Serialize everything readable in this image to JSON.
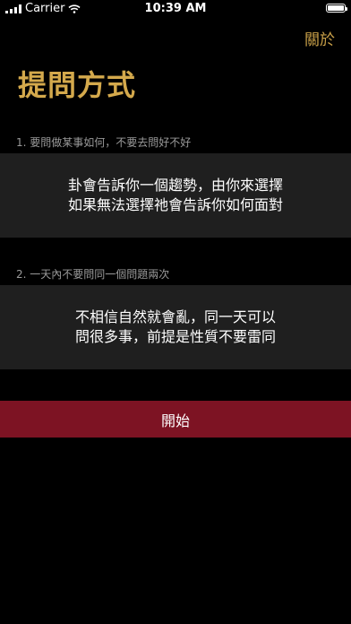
{
  "status_bar": {
    "carrier": "Carrier",
    "time": "10:39 AM",
    "wifi_icon": "wifi-icon",
    "battery_icon": "battery-icon",
    "battery_level": 1.0
  },
  "header": {
    "about_label": "關於",
    "title": "提問方式"
  },
  "sections": [
    {
      "label": "1. 要問做某事如何，不要去問好不好",
      "text_lines": [
        "卦會告訴你一個趨勢，由你來選擇",
        "如果無法選擇祂會告訴你如何面對"
      ]
    },
    {
      "label": "2. 一天內不要問同一個問題兩次",
      "text_lines": [
        "不相信自然就會亂，同一天可以",
        "問很多事，前提是性質不要雷同"
      ]
    }
  ],
  "start_button": {
    "label": "開始"
  },
  "colors": {
    "accent_gold": "#d4a94c",
    "button_red": "#7d1323",
    "card_bg": "#1f1f1f",
    "background": "#000000"
  }
}
